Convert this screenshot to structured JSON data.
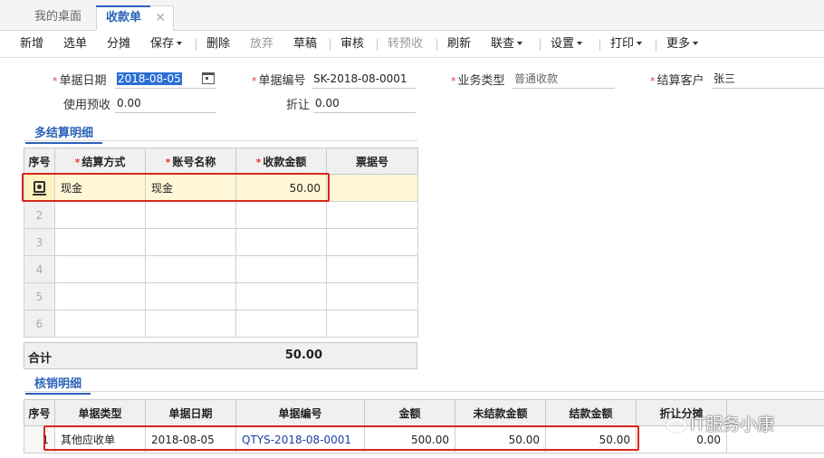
{
  "tabs": {
    "home": "我的桌面",
    "active": "收款单",
    "close": "✕"
  },
  "toolbar": {
    "add": "新增",
    "select": "选单",
    "split": "分摊",
    "save": "保存",
    "delete": "删除",
    "discard": "放弃",
    "draft": "草稿",
    "audit": "审核",
    "to_prepay": "转预收",
    "refresh": "刷新",
    "link": "联查",
    "settings": "设置",
    "print": "打印",
    "more": "更多"
  },
  "form": {
    "req_mark": "*",
    "date_label": "单据日期",
    "date_value": "2018-08-05",
    "no_label": "单据编号",
    "no_value": "SK-2018-08-0001",
    "type_label": "业务类型",
    "type_value": "普通收款",
    "customer_label": "结算客户",
    "customer_value": "张三",
    "prepay_label": "使用预收",
    "prepay_value": "0.00",
    "discount_label": "折让",
    "discount_value": "0.00"
  },
  "settle": {
    "title": "多结算明细",
    "headers": {
      "seq": "序号",
      "method": "结算方式",
      "account": "账号名称",
      "amount": "收款金额",
      "ticket": "票据号"
    },
    "rows": [
      {
        "method": "现金",
        "account": "现金",
        "amount": "50.00",
        "ticket": ""
      }
    ],
    "row_numbers": [
      "2",
      "3",
      "4",
      "5",
      "6"
    ],
    "total_label": "合计",
    "total_value": "50.00"
  },
  "writeoff": {
    "title": "核销明细",
    "headers": {
      "seq": "序号",
      "type": "单据类型",
      "date": "单据日期",
      "no": "单据编号",
      "amount": "金额",
      "unsettled": "未结款金额",
      "settled": "结款金额",
      "alloc": "折让分摊"
    },
    "rows": [
      {
        "seq": "1",
        "type": "其他应收单",
        "date": "2018-08-05",
        "no": "QTYS-2018-08-0001",
        "amount": "500.00",
        "unsettled": "50.00",
        "settled": "50.00",
        "alloc": "0.00"
      }
    ]
  },
  "watermark": "IT服务小康",
  "colors": {
    "accent": "#2a63b8",
    "highlight": "#d9261c",
    "selected_row": "#fff7d6"
  }
}
